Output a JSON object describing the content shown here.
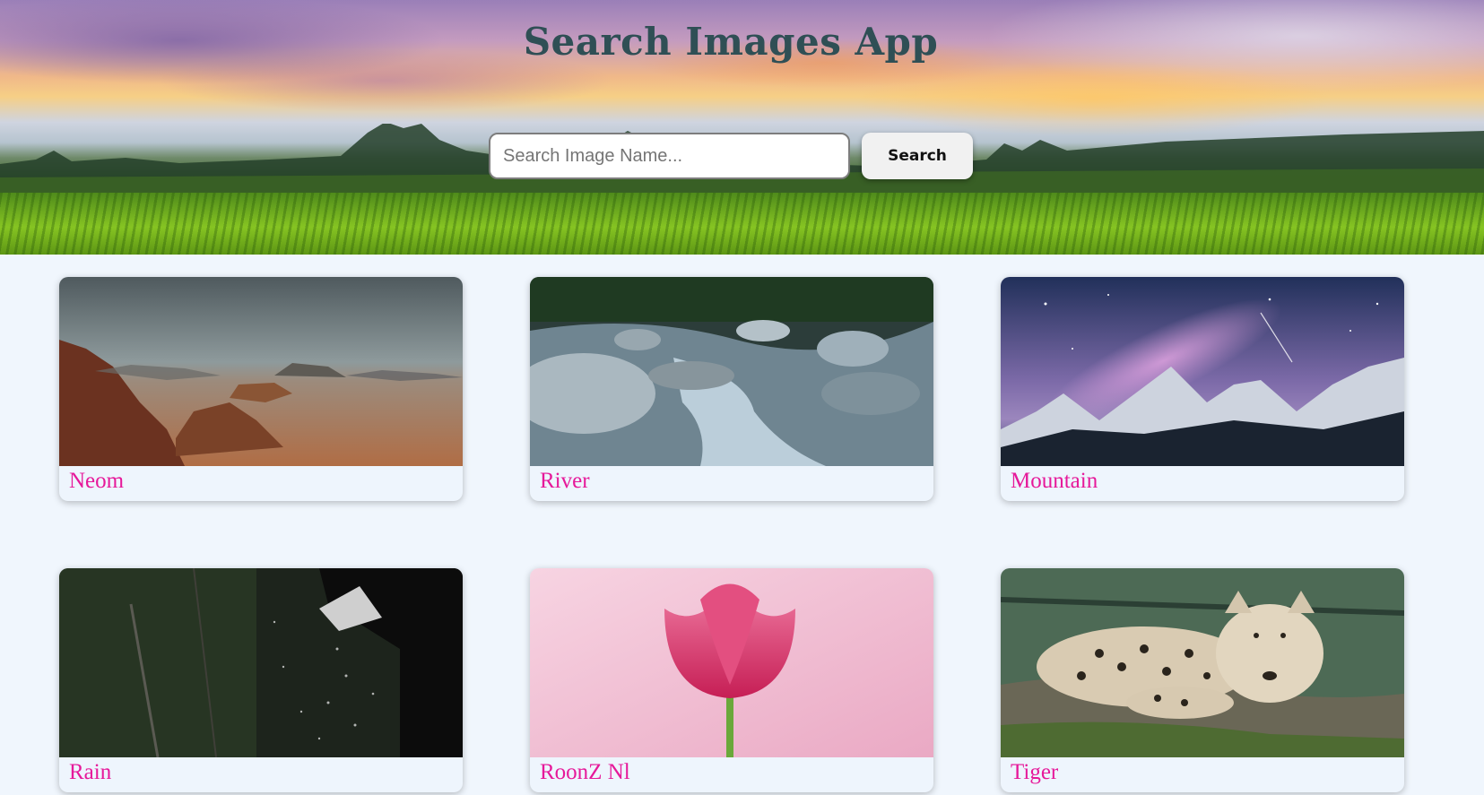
{
  "app": {
    "title": "Search Images App"
  },
  "search": {
    "placeholder": "Search Image Name...",
    "value": "",
    "button_label": "Search"
  },
  "images": [
    {
      "name": "Neom"
    },
    {
      "name": "River"
    },
    {
      "name": "Mountain"
    },
    {
      "name": "Rain"
    },
    {
      "name": "RoonZ Nl"
    },
    {
      "name": "Tiger"
    }
  ],
  "colors": {
    "title": "#2f4f55",
    "caption": "#e6199a",
    "page_background": "#f0f6fd"
  }
}
